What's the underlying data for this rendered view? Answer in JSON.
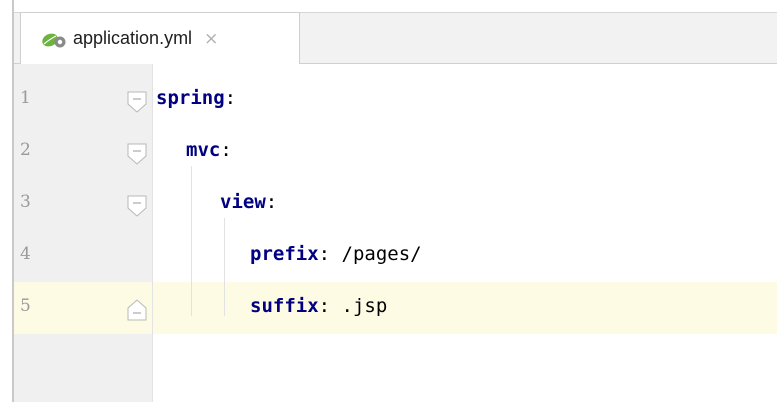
{
  "tab": {
    "icon": "spring-yaml-file-icon",
    "filename": "application.yml",
    "close_glyph": "×"
  },
  "editor": {
    "current_line": 5,
    "lines": [
      {
        "number": "1",
        "key": "spring",
        "separator": ":",
        "value": ""
      },
      {
        "number": "2",
        "key": "mvc",
        "separator": ":",
        "value": ""
      },
      {
        "number": "3",
        "key": "view",
        "separator": ":",
        "value": ""
      },
      {
        "number": "4",
        "key": "prefix",
        "separator": ":",
        "value": " /pages/"
      },
      {
        "number": "5",
        "key": "suffix",
        "separator": ":",
        "value": " .jsp"
      }
    ]
  },
  "colors": {
    "key": "#000080",
    "current_line_bg": "#fefbe5",
    "gutter_bg": "#f0f0f0"
  }
}
